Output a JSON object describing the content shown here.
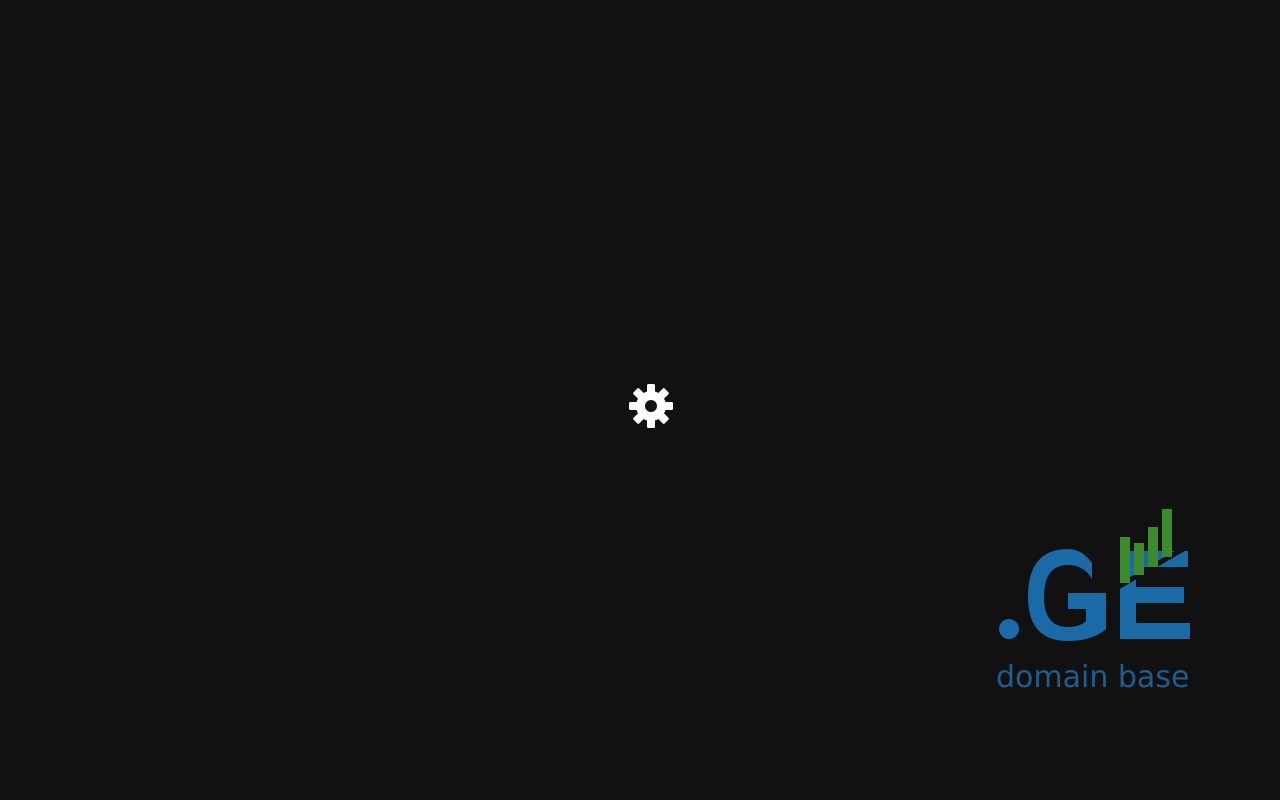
{
  "screen": {
    "background_color": "#111112"
  },
  "loader": {
    "icon": "gear-icon",
    "color": "#ffffff"
  },
  "logo": {
    "mark_text": ".GE",
    "tagline": "domain base",
    "mark_color": "#1a6aa8",
    "tagline_color": "#1d5d8f",
    "bars_color": "#3c8a2e",
    "bars_icon": "signal-bars-icon"
  }
}
